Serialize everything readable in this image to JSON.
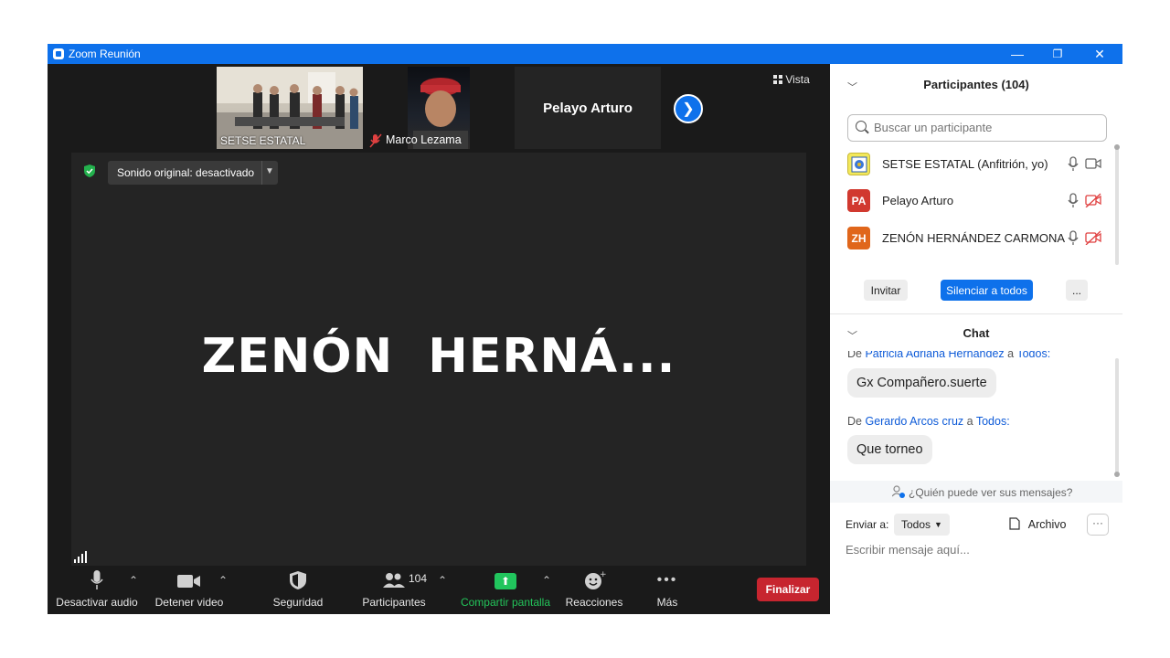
{
  "window": {
    "title": "Zoom Reunión",
    "minimize": "—",
    "restore": "❐",
    "close": "✕"
  },
  "gallery": {
    "tiles": [
      {
        "label": "SETSE ESTATAL"
      },
      {
        "label": "Marco Lezama",
        "muted": true
      },
      {
        "label": "Pelayo Arturo"
      }
    ],
    "next_icon": "chevron-right-icon",
    "view_label": "Vista"
  },
  "main": {
    "speaker": "ZENÓN  HERNÁ...",
    "sound_label": "Sonido original: desactivado"
  },
  "toolbar": {
    "audio": "Desactivar audio",
    "video": "Detener video",
    "security": "Seguridad",
    "participants": "Participantes",
    "participants_count": "104",
    "share": "Compartir pantalla",
    "reactions": "Reacciones",
    "more": "Más",
    "end": "Finalizar"
  },
  "participants_panel": {
    "title": "Participantes (104)",
    "search_placeholder": "Buscar un participante",
    "list": [
      {
        "name": "SETSE ESTATAL (Anfitrión, yo)",
        "initials": "",
        "color": "#f3e85a",
        "cam_off": false
      },
      {
        "name": "Pelayo Arturo",
        "initials": "PA",
        "color": "#d1392f",
        "cam_off": true
      },
      {
        "name": "ZENÓN HERNÁNDEZ CARMONA",
        "initials": "ZH",
        "color": "#e0661b",
        "cam_off": true
      }
    ],
    "invite": "Invitar",
    "mute_all": "Silenciar a todos",
    "more": "..."
  },
  "chat": {
    "title": "Chat",
    "messages": [
      {
        "from_prefix": "De",
        "from": "Patricia Adriana Hernández",
        "to_prefix": "a",
        "to": "Todos:",
        "text": "Gx Compañero.suerte"
      },
      {
        "from_prefix": "De",
        "from": "Gerardo Arcos cruz",
        "to_prefix": "a",
        "to": "Todos:",
        "text": "Que torneo"
      }
    ],
    "who_can_see": "¿Quién puede ver sus mensajes?",
    "send_to_label": "Enviar a:",
    "send_to_value": "Todos",
    "file_label": "Archivo",
    "more": "···",
    "input_placeholder": "Escribir mensaje aquí..."
  },
  "colors": {
    "accent": "#0e71eb",
    "end": "#c7252f",
    "share": "#21c55d"
  }
}
